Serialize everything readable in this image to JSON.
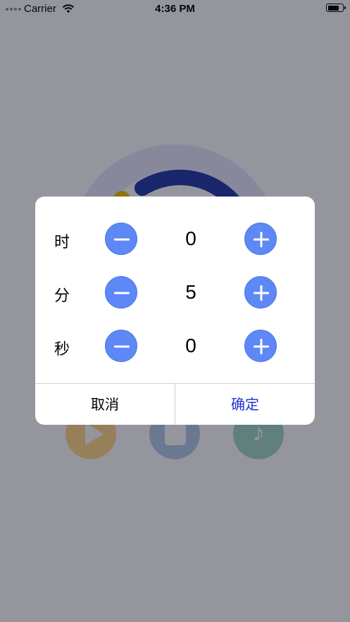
{
  "status_bar": {
    "carrier": "Carrier",
    "time": "4:36 PM"
  },
  "timer_ring": {
    "track_color": "#e8e8ff",
    "progress_color": "#233aa8",
    "accent_color": "#f5c400"
  },
  "controls": [
    {
      "name": "play",
      "icon": "play-icon",
      "color": "#ffd98a"
    },
    {
      "name": "stop",
      "icon": "stop-icon",
      "color": "#b5cbeb"
    },
    {
      "name": "music",
      "icon": "music-note-icon",
      "color": "#9fd9c6"
    }
  ],
  "dialog": {
    "rows": [
      {
        "label": "时",
        "value": "0"
      },
      {
        "label": "分",
        "value": "5"
      },
      {
        "label": "秒",
        "value": "0"
      }
    ],
    "cancel_label": "取消",
    "confirm_label": "确定",
    "button_color": "#5d88f6",
    "confirm_color": "#1e32d6"
  }
}
